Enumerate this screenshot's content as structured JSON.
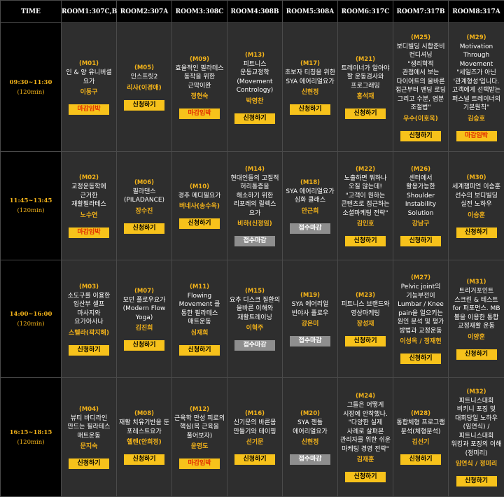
{
  "header": {
    "time": "TIME",
    "rooms": [
      "ROOM1:307C,B",
      "ROOM2:307A",
      "ROOM3:308C",
      "ROOM4:308B",
      "ROOM5:308A",
      "ROOM6:317C",
      "ROOM7:317B",
      "ROOM8:317A"
    ]
  },
  "slots": [
    {
      "time": "09:30~11:30",
      "duration": "(120min)",
      "sessions": [
        {
          "code": "(M01)",
          "title": "인 & 양 유니버셜 요가",
          "instructor": "이동구",
          "button": "마감임박",
          "state": "closed"
        },
        {
          "code": "(M05)",
          "title": "인스프릿2",
          "instructor": "리사(이경애)",
          "button": "신청하기",
          "state": "apply"
        },
        {
          "code": "(M09)",
          "title": "효율적인 필라테스 동작을 위한 근막이완",
          "instructor": "정현숙",
          "button": "마감임박",
          "state": "closed"
        },
        {
          "code": "(M13)",
          "title": "피트니스 운동교정학(Movement Contrology)",
          "instructor": "박영찬",
          "button": "신청하기",
          "state": "apply"
        },
        {
          "code": "(M17)",
          "title": "초보자 티칭을 위한 SYA 에어리얼요가",
          "instructor": "신현정",
          "button": "신청하기",
          "state": "apply"
        },
        {
          "code": "(M21)",
          "title": "트레이너가 알아야 할 운동검사와 프로그래밍",
          "instructor": "홍석재",
          "button": "신청하기",
          "state": "apply"
        },
        {
          "code": "(M25)",
          "title": "보디빌딩 시합준비 컨디셔닝 \"생리학적 관점에서 보는 다이어트의 올바른 접근부터 밴딩 로딩 그리고 수분, 염분 조절법\"",
          "instructor": "우수(이호욱)",
          "button": "신청하기",
          "state": "apply"
        },
        {
          "code": "(M29)",
          "title": "Motivation Through Movement \"세일즈가 아닌 '관계형성'입니다. 고객에게 선택받는 퍼스널 트레이너의 기본원칙\"",
          "instructor": "김승호",
          "button": "마감임박",
          "state": "closed"
        }
      ]
    },
    {
      "time": "11:45~13:45",
      "duration": "(120min)",
      "sessions": [
        {
          "code": "(M02)",
          "title": "교정운동학에 근거한 재활필라테스",
          "instructor": "노수연",
          "button": "마감임박",
          "state": "closed"
        },
        {
          "code": "(M06)",
          "title": "필라댄스 (PILADANCE)",
          "instructor": "장수진",
          "button": "신청하기",
          "state": "apply"
        },
        {
          "code": "(M10)",
          "title": "경추 메디필요가",
          "instructor": "버네사(송수옥)",
          "button": "신청하기",
          "state": "apply"
        },
        {
          "code": "(M14)",
          "title": "현대인들의 고질적 허리통증을 해소하기 위한 리포레의 릴렉스 요가",
          "instructor": "비하(신정임)",
          "button": "접수마감",
          "state": "full"
        },
        {
          "code": "(M18)",
          "title": "SYA 에어리얼요가 심화 클래스",
          "instructor": "안근희",
          "button": "접수마감",
          "state": "full"
        },
        {
          "code": "(M22)",
          "title": "노출하면 뭐하나 오질 않는데! \"고객이 원하는 콘텐츠로 접근하는 소셜마케팅 전략\"",
          "instructor": "김인호",
          "button": "신청하기",
          "state": "apply"
        },
        {
          "code": "(M26)",
          "title": "센터에서 활용가능한 Shoulder Instability Solution",
          "instructor": "강남구",
          "button": "신청하기",
          "state": "apply"
        },
        {
          "code": "(M30)",
          "title": "세계챔피언 이승훈 선수의 보디빌딩 실전 노하우",
          "instructor": "이승훈",
          "button": "신청하기",
          "state": "apply"
        }
      ]
    },
    {
      "time": "14:00~16:00",
      "duration": "(120min)",
      "sessions": [
        {
          "code": "(M03)",
          "title": "소도구를 이용한 임산부 셀프 마사지와 요가아사나",
          "instructor": "스텔라(곽지해)",
          "button": "신청하기",
          "state": "apply"
        },
        {
          "code": "(M07)",
          "title": "모던 플로우요가 (Modern Flow Yoga)",
          "instructor": "김진희",
          "button": "신청하기",
          "state": "apply"
        },
        {
          "code": "(M11)",
          "title": "Flowing Movement 를 통한 필라테스 매트운동",
          "instructor": "심재희",
          "button": "신청하기",
          "state": "apply"
        },
        {
          "code": "(M15)",
          "title": "요추 디스크 질환의 올바른 이해와 재활트레이닝",
          "instructor": "이혁주",
          "button": "접수마감",
          "state": "full"
        },
        {
          "code": "(M19)",
          "title": "SYA 에어리얼 빈야사 플로우",
          "instructor": "강은미",
          "button": "접수마감",
          "state": "full"
        },
        {
          "code": "(M23)",
          "title": "피트니스 브랜드와 영상마케팅",
          "instructor": "장성재",
          "button": "신청하기",
          "state": "apply"
        },
        {
          "code": "(M27)",
          "title": "Pelvic joint의 기능부전이 Lumbar / Knee pain을 일으키는 원인 분석 및 평가 방법과 교정운동",
          "instructor": "이성옥 / 정재헌",
          "button": "신청하기",
          "state": "apply"
        },
        {
          "code": "(M31)",
          "title": "트리거포인트 스크린 & 테스트 for 퍼포먼스. MB 볼을 이용한 통합 교정재활 운동",
          "instructor": "이양훈",
          "button": "신청하기",
          "state": "apply"
        }
      ]
    },
    {
      "time": "16:15~18:15",
      "duration": "(120min)",
      "sessions": [
        {
          "code": "(M04)",
          "title": "뷰티 바디라인 만드는 필라테스 매트운동",
          "instructor": "문지숙",
          "button": "신청하기",
          "state": "apply"
        },
        {
          "code": "(M08)",
          "title": "재활 치유기반을 둔 포레스트요가",
          "instructor": "헬렌(안희정)",
          "button": "신청하기",
          "state": "apply"
        },
        {
          "code": "(M12)",
          "title": "근육학 만성 피로의 핵심(목 근육을 풀어보자)",
          "instructor": "윤영도",
          "button": "마감임박",
          "state": "closed"
        },
        {
          "code": "(M16)",
          "title": "신기문의 바른몸 만들기와 테이핑",
          "instructor": "선기문",
          "button": "신청하기",
          "state": "apply"
        },
        {
          "code": "(M20)",
          "title": "SYA 젠틀 에어리얼요가",
          "instructor": "신현정",
          "button": "접수마감",
          "state": "full"
        },
        {
          "code": "(M24)",
          "title": "그들은 어떻게 시장에 안착했나. \"다양한 실제 사례로 살펴본 관리자를 위한 쉬운 마케팅 경영 전략\"",
          "instructor": "김재훈",
          "button": "신청하기",
          "state": "apply"
        },
        {
          "code": "(M28)",
          "title": "통합체형 프로그램 분석(체형분석)",
          "instructor": "김선기",
          "button": "신청하기",
          "state": "apply"
        },
        {
          "code": "(M32)",
          "title": "피트니스대회 비키니 포징 및 대회당일 노하우(임연식) / 피트니스대회 워킹과 포징의 이해(정미리)",
          "instructor": "임연식 / 정미리",
          "button": "신청하기",
          "state": "apply"
        }
      ]
    }
  ]
}
